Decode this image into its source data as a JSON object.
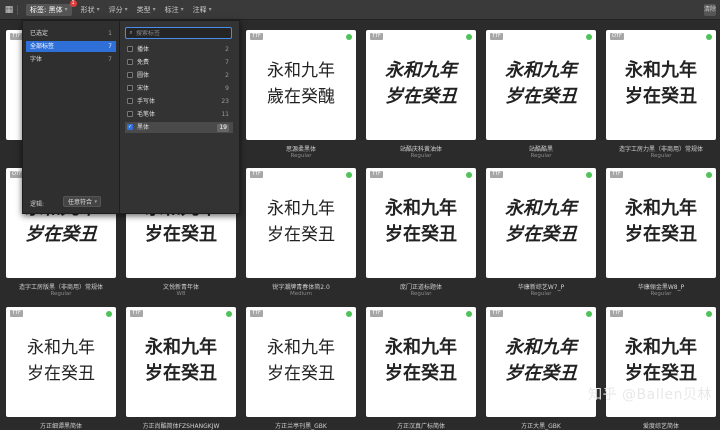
{
  "toolbar": {
    "menu_icon": "grid-icon",
    "filters": [
      {
        "label": "标签: 黑体",
        "active": true,
        "badge": "1"
      },
      {
        "label": "形状",
        "active": false
      },
      {
        "label": "评分",
        "active": false
      },
      {
        "label": "类型",
        "active": false
      },
      {
        "label": "标注",
        "active": false
      },
      {
        "label": "注释",
        "active": false
      }
    ],
    "right_label": "清除"
  },
  "dropdown": {
    "left_items": [
      {
        "label": "已选定",
        "count": "1"
      },
      {
        "label": "全部标签",
        "count": "7"
      },
      {
        "label": "字体",
        "count": "7"
      }
    ],
    "logic_label": "逻辑:",
    "logic_value": "任意符合",
    "search_placeholder": "搜索标签",
    "right_items": [
      {
        "label": "播体",
        "count": "2",
        "checked": false
      },
      {
        "label": "免费",
        "count": "7",
        "checked": false
      },
      {
        "label": "圆体",
        "count": "2",
        "checked": false
      },
      {
        "label": "宋体",
        "count": "9",
        "checked": false
      },
      {
        "label": "手写体",
        "count": "23",
        "checked": false
      },
      {
        "label": "毛笔体",
        "count": "11",
        "checked": false
      },
      {
        "label": "黑体",
        "count": "19",
        "checked": true
      }
    ]
  },
  "fonts": [
    {
      "type": "TTF",
      "name": "",
      "sub": "",
      "line1": "",
      "line2": ""
    },
    {
      "type": "TTF",
      "name": "",
      "sub": "",
      "line1": "",
      "line2": ""
    },
    {
      "type": "TTF",
      "name": "思源柔黑体",
      "sub": "Regular",
      "line1": "永和九年",
      "line2": "歲在癸醜"
    },
    {
      "type": "TTF",
      "name": "站酷庆科黄油体",
      "sub": "Regular",
      "line1": "永和九年",
      "line2": "岁在癸丑"
    },
    {
      "type": "TTF",
      "name": "站酷酷黑",
      "sub": "Regular",
      "line1": "永和九年",
      "line2": "岁在癸丑"
    },
    {
      "type": "OTF",
      "name": "造字工房力黑（非商用）常规体",
      "sub": "Regular",
      "line1": "永和九年",
      "line2": "岁在癸丑"
    },
    {
      "type": "OTF",
      "name": "造字工房版黑（非商用）常规体",
      "sub": "Regular",
      "line1": "永和九年",
      "line2": "岁在癸丑"
    },
    {
      "type": "TTF",
      "name": "文悦新青年体",
      "sub": "W8",
      "line1": "永和九年",
      "line2": "岁在癸丑"
    },
    {
      "type": "TTF",
      "name": "锐字潮牌青春体简2.0",
      "sub": "Medium",
      "line1": "永和九年",
      "line2": "岁在癸丑"
    },
    {
      "type": "TTF",
      "name": "庞门正道标题体",
      "sub": "Regular",
      "line1": "永和九年",
      "line2": "岁在癸丑"
    },
    {
      "type": "TTF",
      "name": "华康新综艺W7_P",
      "sub": "Regular",
      "line1": "永和九年",
      "line2": "岁在癸丑"
    },
    {
      "type": "TTF",
      "name": "华康俪金黑W8_P",
      "sub": "Regular",
      "line1": "永和九年",
      "line2": "岁在癸丑"
    },
    {
      "type": "TTF",
      "name": "方正细谭黑简体",
      "sub": "",
      "line1": "永和九年",
      "line2": "岁在癸丑"
    },
    {
      "type": "TTF",
      "name": "方正尚酷简体FZSHANGKJW",
      "sub": "",
      "line1": "永和九年",
      "line2": "岁在癸丑"
    },
    {
      "type": "TTF",
      "name": "方正兰亭刊黑_GBK",
      "sub": "",
      "line1": "永和九年",
      "line2": "岁在癸丑"
    },
    {
      "type": "TTF",
      "name": "方正汉真广标简体",
      "sub": "",
      "line1": "永和九年",
      "line2": "岁在癸丑"
    },
    {
      "type": "TTF",
      "name": "方正大黑_GBK",
      "sub": "",
      "line1": "永和九年",
      "line2": "岁在癸丑"
    },
    {
      "type": "TTF",
      "name": "爱度综艺简体",
      "sub": "",
      "line1": "永和九年",
      "line2": "岁在癸丑"
    }
  ],
  "watermark": "知乎 @Ballen贝林"
}
